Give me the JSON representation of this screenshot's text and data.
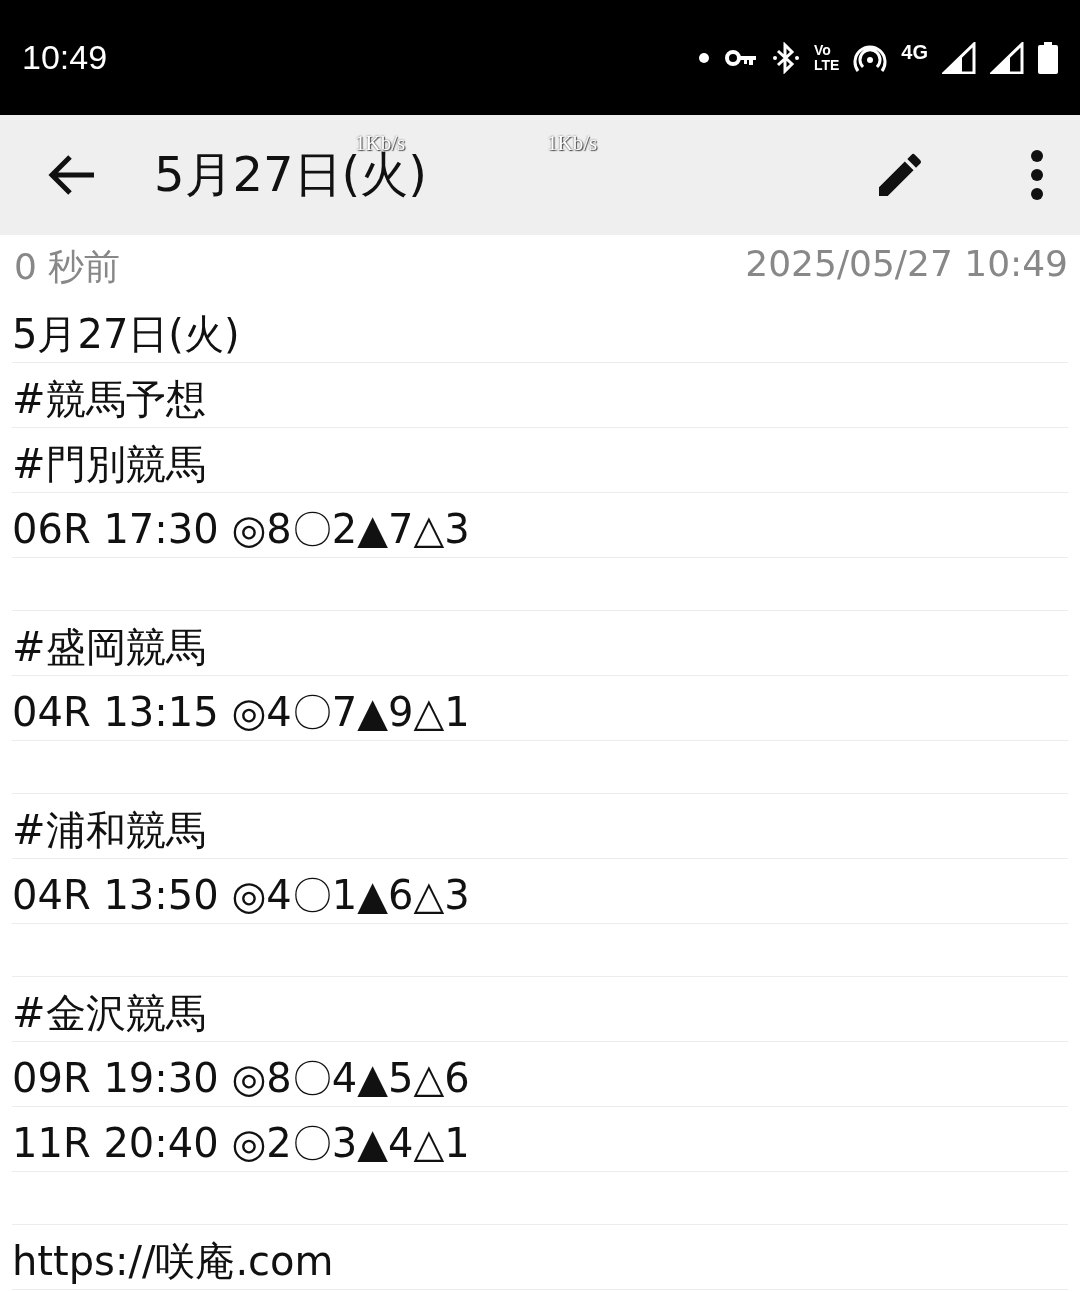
{
  "status_bar": {
    "time": "10:49",
    "volte_top": "Vo",
    "volte_bottom": "LTE",
    "network": "4G"
  },
  "speed_overlays": [
    "1Kb/s",
    "1Kb/s"
  ],
  "toolbar": {
    "title": "5月27日(火)"
  },
  "meta": {
    "relative": "0 秒前",
    "timestamp": "2025/05/27 10:49"
  },
  "lines": [
    {
      "kind": "text",
      "text": "5月27日(火)"
    },
    {
      "kind": "text",
      "text": "#競馬予想"
    },
    {
      "kind": "text",
      "text": "#門別競馬"
    },
    {
      "kind": "text",
      "text": "06R 17:30 ◎8〇2▲7△3"
    },
    {
      "kind": "blank"
    },
    {
      "kind": "text",
      "text": "#盛岡競馬"
    },
    {
      "kind": "text",
      "text": "04R 13:15 ◎4〇7▲9△1"
    },
    {
      "kind": "blank"
    },
    {
      "kind": "text",
      "text": "#浦和競馬"
    },
    {
      "kind": "text",
      "text": "04R 13:50 ◎4〇1▲6△3"
    },
    {
      "kind": "blank"
    },
    {
      "kind": "text",
      "text": "#金沢競馬"
    },
    {
      "kind": "text",
      "text": "09R 19:30 ◎8〇4▲5△6"
    },
    {
      "kind": "text",
      "text": "11R 20:40 ◎2〇3▲4△1"
    },
    {
      "kind": "blank"
    },
    {
      "kind": "text",
      "text": "https://咲庵.com"
    }
  ]
}
